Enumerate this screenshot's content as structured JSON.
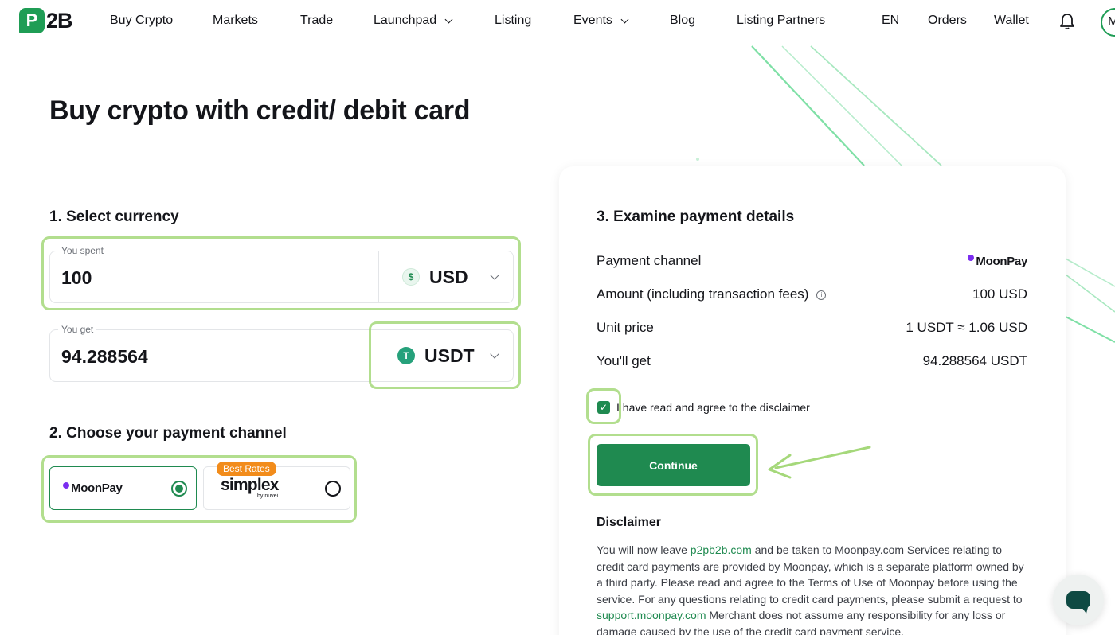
{
  "header": {
    "logo": "P2B",
    "nav": [
      {
        "label": "Buy Crypto"
      },
      {
        "label": "Markets"
      },
      {
        "label": "Trade"
      },
      {
        "label": "Launchpad"
      },
      {
        "label": "Listing"
      },
      {
        "label": "Events"
      },
      {
        "label": "Blog"
      },
      {
        "label": "Listing Partners"
      }
    ],
    "lang": "EN",
    "orders": "Orders",
    "wallet": "Wallet",
    "avatar_initial": "M"
  },
  "page": {
    "title": "Buy crypto with credit/ debit card"
  },
  "step1": {
    "title": "1. Select currency",
    "spend": {
      "label": "You spent",
      "value": "100",
      "currency": "USD",
      "currency_icon": "$"
    },
    "get": {
      "label": "You get",
      "value": "94.288564",
      "currency": "USDT",
      "currency_icon": "T"
    }
  },
  "step2": {
    "title": "2. Choose your payment channel",
    "options": [
      {
        "name": "MoonPay",
        "selected": true
      },
      {
        "name": "simplex",
        "sub": "by nuvei",
        "badge": "Best Rates",
        "selected": false
      }
    ]
  },
  "step3": {
    "title": "3. Examine payment details",
    "rows": [
      {
        "label": "Payment channel",
        "value": "MoonPay"
      },
      {
        "label": "Amount (including transaction fees)",
        "value": "100 USD"
      },
      {
        "label": "Unit price",
        "value": "1 USDT ≈ 1.06 USD"
      },
      {
        "label": "You'll get",
        "value": "94.288564 USDT"
      }
    ],
    "agree_label": "I have read and agree to the disclaimer",
    "agree_checked": true,
    "continue_label": "Continue",
    "disclaimer_title": "Disclaimer",
    "disclaimer": {
      "p1": "You will now leave ",
      "link1": "p2pb2b.com",
      "p2": " and be taken to Moonpay.com Services relating to credit card payments are provided by Moonpay, which is a separate platform owned by a third party. Please read and agree to the Terms of Use of Moonpay before using the service. For any questions relating to credit card payments, please submit a request to ",
      "link2": "support.moonpay.com",
      "p3": " Merchant does not assume any responsibility for any loss or damage caused by the use of the credit card payment service."
    }
  },
  "colors": {
    "brand_green": "#1f8a50",
    "highlight": "#a5d87a",
    "moonpay_purple": "#7b2df0",
    "badge_orange": "#f28c1b"
  }
}
